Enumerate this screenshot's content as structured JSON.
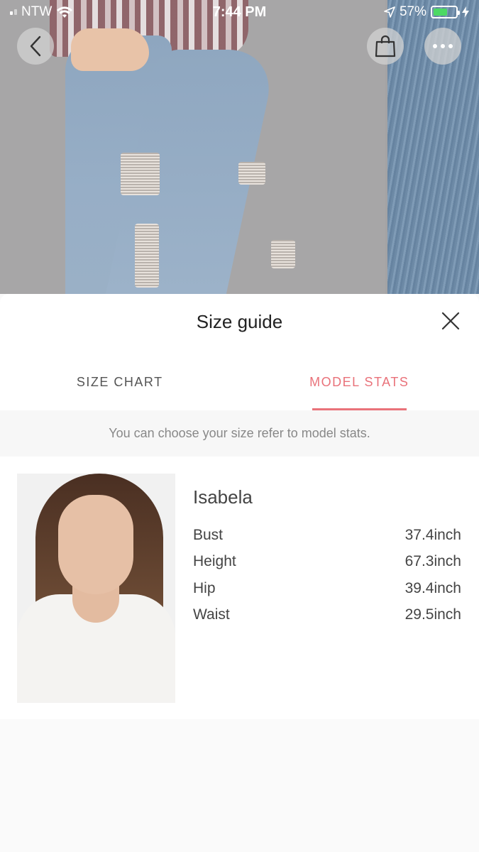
{
  "status_bar": {
    "carrier": "NTW",
    "time": "7:44 PM",
    "battery_percent": "57%",
    "battery_level": 0.57,
    "battery_color": "#4cd964"
  },
  "top_buttons": {
    "back_icon": "chevron-left-icon",
    "bag_icon": "shopping-bag-icon",
    "more_icon": "more-icon"
  },
  "sheet": {
    "title": "Size guide",
    "tabs": [
      {
        "label": "SIZE CHART",
        "active": false
      },
      {
        "label": "MODEL STATS",
        "active": true
      }
    ],
    "accent_color": "#e9727a",
    "notice": "You can choose your size refer to model stats.",
    "model": {
      "name": "Isabela",
      "stats": [
        {
          "label": "Bust",
          "value": "37.4inch"
        },
        {
          "label": "Height",
          "value": "67.3inch"
        },
        {
          "label": "Hip",
          "value": "39.4inch"
        },
        {
          "label": "Waist",
          "value": "29.5inch"
        }
      ]
    }
  }
}
